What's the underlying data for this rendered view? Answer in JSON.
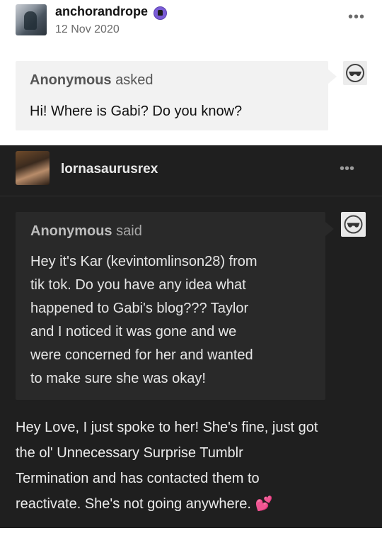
{
  "post": {
    "username": "anchorandrope",
    "date": "12 Nov 2020",
    "more_icon": "ellipsis-icon",
    "ask": {
      "asker": "Anonymous",
      "verb": "asked",
      "question": "Hi! Where is Gabi? Do you know?"
    }
  },
  "reblog": {
    "username": "lornasaurusrex",
    "more_icon": "ellipsis-icon",
    "quoted": {
      "asker": "Anonymous",
      "verb": "said",
      "lines": [
        "Hey it's Kar (kevintomlinson28) from",
        "tik tok. Do you have any idea what",
        "happened to Gabi's blog??? Taylor",
        "and I noticed it was gone and we",
        "were concerned for her and wanted",
        "to make sure she was okay!"
      ]
    },
    "reply_lines": [
      "Hey Love, I just spoke to her! She's fine, just got",
      "the ol' Unnecessary Surprise Tumblr",
      "Termination and has contacted them to",
      "reactivate. She's not going anywhere."
    ],
    "reply_emoji": "💕"
  },
  "colors": {
    "dark_bg": "#1f1f1f",
    "quote_bg": "#292929",
    "ask_bg": "#f2f2f2",
    "heart": "#ff4fa8",
    "badge": "#7a5cd6"
  }
}
